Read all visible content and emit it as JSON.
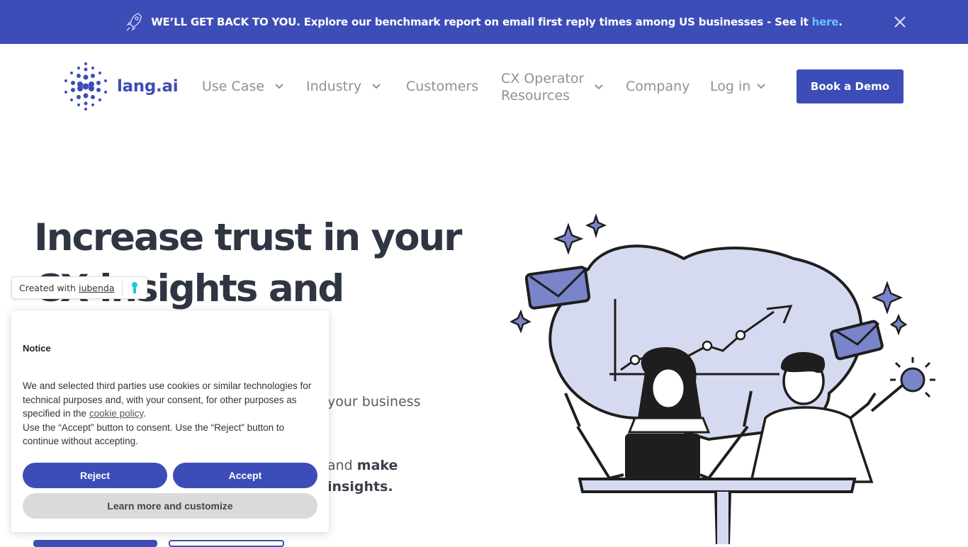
{
  "announcement": {
    "icon": "rocket-icon",
    "text": "WE’LL GET BACK TO YOU. Explore our benchmark report on email first reply times among US businesses - See it ",
    "link_text": "here",
    "suffix": ".",
    "close_icon": "close-icon"
  },
  "header": {
    "logo_text": "lang.ai",
    "nav": [
      {
        "label": "Use Case",
        "has_dropdown": true
      },
      {
        "label": "Industry",
        "has_dropdown": true
      },
      {
        "label": "Customers",
        "has_dropdown": false
      },
      {
        "label_line1": "CX Operator",
        "label_line2": "Resources",
        "has_dropdown": true
      },
      {
        "label": "Company",
        "has_dropdown": false
      },
      {
        "label": "Log in",
        "has_dropdown": true
      }
    ],
    "cta": "Book a Demo"
  },
  "hero": {
    "title_line1": "Increase trust in your",
    "title_line2": "CX insights and",
    "frag1": "your business",
    "frag2_plain": "and ",
    "frag2_bold": "make",
    "frag3": "insights."
  },
  "consent": {
    "badge_text": "Created with",
    "badge_link": "iubenda",
    "title": "Notice",
    "body_part1": "We and selected third parties use cookies or similar technologies for technical purposes and, with your consent, for other purposes as specified in the ",
    "cookie_policy_link": "cookie policy",
    "body_part2": ".",
    "body_line2": "Use the “Accept” button to consent. Use the “Reject” button to continue without accepting.",
    "reject": "Reject",
    "accept": "Accept",
    "learn_more": "Learn more and customize"
  },
  "colors": {
    "brand_blue": "#3d4db7",
    "illustration_lavender": "#d6daf0",
    "accent_purple": "#7a84c9",
    "link_blue": "#6ec1ff"
  }
}
